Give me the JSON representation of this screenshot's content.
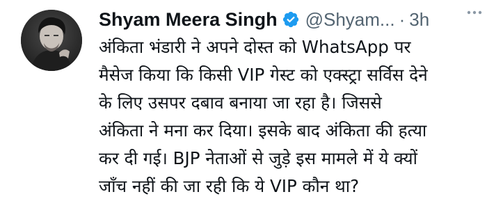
{
  "tweet": {
    "author_name": "Shyam Meera Singh",
    "handle": "@Shyam...",
    "separator": "·",
    "time": "3h",
    "more_icon": "ellipsis-icon",
    "verified_icon": "verified-badge-icon",
    "lines": [
      "अंकिता भंडारी ने अपने दोस्त को WhatsApp पर",
      "मैसेज किया कि किसी VIP गेस्ट को एक्स्ट्रा सर्विस देने",
      "के लिए उसपर दबाव बनाया जा रहा है। जिससे",
      "अंकिता ने मना कर दिया। इसके बाद अंकिता की हत्या",
      "कर दी गई। BJP नेताओं से जुड़े इस मामले में ये क्यों",
      "जाँच नहीं की जा रही कि ये VIP कौन था?"
    ]
  },
  "colors": {
    "text": "#0f1419",
    "muted": "#536471",
    "verified": "#1d9bf0",
    "background": "#ffffff"
  }
}
